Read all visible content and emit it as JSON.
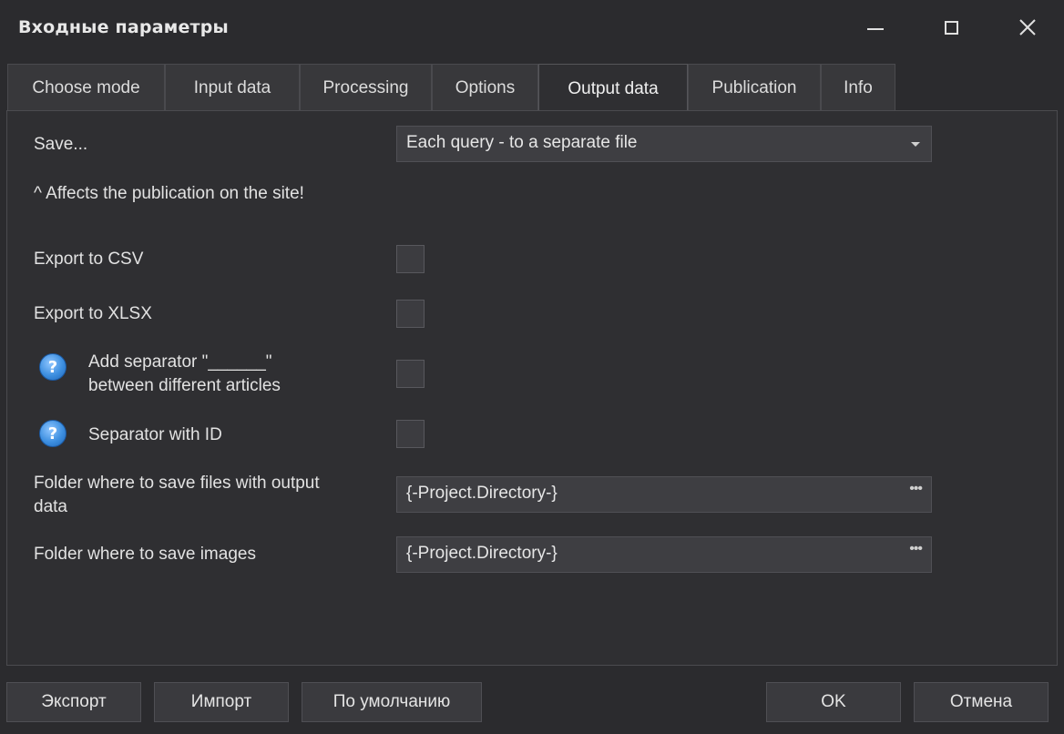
{
  "window": {
    "title": "Входные параметры"
  },
  "tabs": [
    {
      "label": "Choose mode"
    },
    {
      "label": "Input data"
    },
    {
      "label": "Processing"
    },
    {
      "label": "Options"
    },
    {
      "label": "Output data",
      "active": true
    },
    {
      "label": "Publication"
    },
    {
      "label": "Info"
    }
  ],
  "form": {
    "save_label": "Save...",
    "save_value": "Each query - to a separate file",
    "note": "^ Affects the publication on the site!",
    "export_csv_label": "Export to CSV",
    "export_csv_checked": false,
    "export_xlsx_label": "Export to XLSX",
    "export_xlsx_checked": false,
    "separator_label_line1": "Add separator \"______\"",
    "separator_label_line2": "between different articles",
    "separator_checked": false,
    "separator_id_label": "Separator with ID",
    "separator_id_checked": false,
    "output_folder_label_line1": "Folder where to save files with output",
    "output_folder_label_line2": "data",
    "output_folder_value": "{-Project.Directory-}",
    "images_folder_label": "Folder where to save images",
    "images_folder_value": "{-Project.Directory-}",
    "browse_glyph": "•••",
    "help_glyph": "?"
  },
  "buttons": {
    "export": "Экспорт",
    "import": "Импорт",
    "defaults": "По умолчанию",
    "ok": "OK",
    "cancel": "Отмена"
  },
  "colors": {
    "background": "#2b2b2e",
    "panel": "#2f2f32",
    "input": "#3e3e42",
    "help_icon": "#3d8fe0"
  }
}
